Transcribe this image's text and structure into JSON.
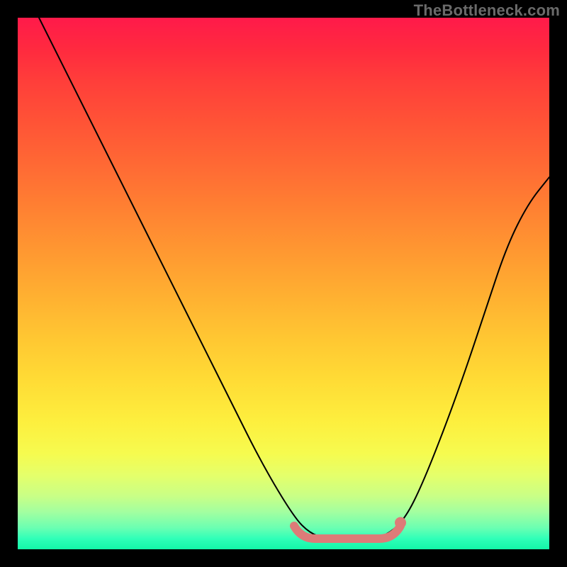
{
  "watermark": "TheBottleneck.com",
  "chart_data": {
    "type": "line",
    "title": "",
    "xlabel": "",
    "ylabel": "",
    "xlim": [
      0,
      100
    ],
    "ylim": [
      0,
      100
    ],
    "grid": false,
    "legend": false,
    "background": "rainbow-vertical",
    "series": [
      {
        "name": "bottleneck-curve",
        "color": "#000000",
        "x": [
          4,
          10,
          16,
          22,
          28,
          34,
          40,
          46,
          52,
          55,
          58,
          61,
          64,
          67,
          70,
          73,
          76,
          80,
          84,
          88,
          92,
          96,
          100
        ],
        "y": [
          100,
          88,
          76,
          64,
          52,
          40,
          28,
          16,
          6,
          3,
          2,
          1.5,
          1.5,
          2,
          3,
          6,
          12,
          22,
          33,
          45,
          57,
          65,
          70
        ]
      }
    ],
    "highlight": {
      "name": "optimal-range",
      "color": "#dd7b78",
      "x_range": [
        52,
        72
      ],
      "y_level": 2,
      "end_dot": {
        "x": 72,
        "y": 5
      }
    },
    "notes": "Values are read off the image pixel grid and normalized to 0-100 on both axes; y=0 at bottom. Precision ~±3."
  }
}
